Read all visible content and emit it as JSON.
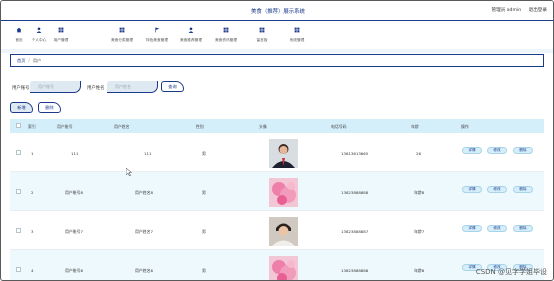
{
  "header": {
    "title": "美食（推荐）展示系统",
    "user_label": "管理员 admin",
    "logout_label": "退出登录"
  },
  "nav": [
    {
      "label": "首页",
      "icon": "home-icon"
    },
    {
      "label": "个人中心",
      "icon": "person-icon"
    },
    {
      "label": "用户管理",
      "icon": "users-icon"
    },
    {
      "label": "美食分类管理",
      "icon": "grid-icon"
    },
    {
      "label": "特色美食管理",
      "icon": "flag-icon"
    },
    {
      "label": "美食推荐管理",
      "icon": "user-icon"
    },
    {
      "label": "美食资讯管理",
      "icon": "grid-icon"
    },
    {
      "label": "留言板",
      "icon": "grid-icon"
    },
    {
      "label": "系统管理",
      "icon": "grid-icon"
    }
  ],
  "breadcrumb": {
    "home": "首页",
    "separator": "/",
    "current": "用户"
  },
  "search": {
    "account_label": "用户账号",
    "account_placeholder": "用户账号",
    "name_label": "用户姓名",
    "name_placeholder": "用户姓名",
    "search_button": "查询"
  },
  "toolbar": {
    "add_label": "新增",
    "delete_label": "删除"
  },
  "table": {
    "headers": [
      "索引",
      "用户账号",
      "用户姓名",
      "性别",
      "头像",
      "电话号码",
      "年龄",
      "操作"
    ],
    "rows": [
      {
        "index": "1",
        "account": "111",
        "name": "111",
        "gender": "男",
        "phone": "13613613665",
        "age": "26",
        "avatar": "man-suit"
      },
      {
        "index": "2",
        "account": "用户账号8",
        "name": "用户姓名8",
        "gender": "男",
        "phone": "13823888888",
        "age": "年龄8",
        "avatar": "pink-flower"
      },
      {
        "index": "3",
        "account": "用户账号7",
        "name": "用户姓名7",
        "gender": "男",
        "phone": "13823888887",
        "age": "年龄7",
        "avatar": "young-man"
      },
      {
        "index": "4",
        "account": "用户账号6",
        "name": "用户姓名6",
        "gender": "男",
        "phone": "13823888886",
        "age": "年龄6",
        "avatar": "pink-flower"
      }
    ],
    "actions": [
      "详情",
      "修改",
      "删除"
    ]
  },
  "watermark": "CSDN @见字学姐毕设",
  "colors": {
    "primary": "#1c3a8c",
    "header_row": "#d4eefa",
    "alt_row": "#eef9fd",
    "input_bg": "#dfe9f1"
  }
}
